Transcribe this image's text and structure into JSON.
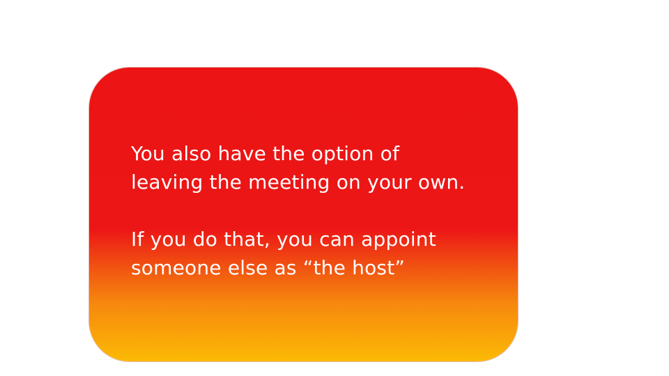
{
  "slide": {
    "paragraphs": [
      "You also have the option of\nleaving the meeting on your own.",
      "If you do that, you can appoint\nsomeone else as “the host”"
    ]
  },
  "colors": {
    "card_top": "#ec1414",
    "card_bottom": "#fcba05",
    "text": "#ffffff",
    "background": "#ffffff"
  }
}
